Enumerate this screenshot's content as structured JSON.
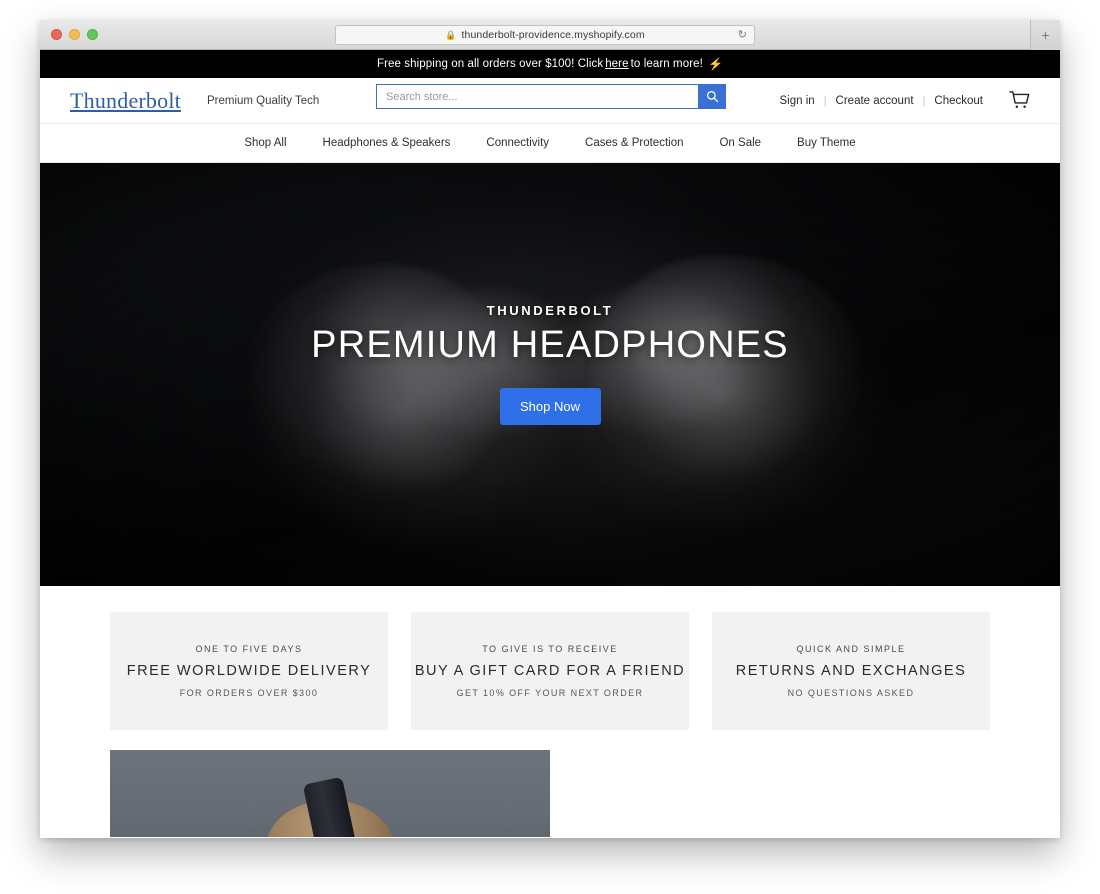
{
  "browser": {
    "url": "thunderbolt-providence.myshopify.com",
    "lock_icon": "lock-icon",
    "reload_icon": "reload-icon",
    "newtab_label": "+",
    "traffic_lights": [
      "close",
      "minimize",
      "zoom"
    ]
  },
  "announcement": {
    "text_before": "Free shipping on all orders over $100! Click",
    "link_label": "here",
    "text_after": "to learn more!",
    "bolt_icon": "lightning-bolt-icon"
  },
  "header": {
    "logo": "Thunderbolt",
    "tagline": "Premium Quality Tech",
    "logo_color": "#2d5fa8",
    "search": {
      "placeholder": "Search store...",
      "value": "",
      "button_icon": "search-icon",
      "accent_color": "#3a6fd4"
    },
    "links": [
      {
        "label": "Sign in"
      },
      {
        "label": "Create account"
      },
      {
        "label": "Checkout"
      }
    ],
    "separator": "|",
    "cart_icon": "shopping-cart-icon"
  },
  "nav": {
    "items": [
      {
        "label": "Shop All"
      },
      {
        "label": "Headphones & Speakers"
      },
      {
        "label": "Connectivity"
      },
      {
        "label": "Cases & Protection"
      },
      {
        "label": "On Sale"
      },
      {
        "label": "Buy Theme"
      }
    ]
  },
  "hero": {
    "eyebrow": "THUNDERBOLT",
    "title": "PREMIUM HEADPHONES",
    "cta_label": "Shop Now",
    "cta_color": "#2f6fe8",
    "image_alt": "black over-ear headphones on dark background"
  },
  "features": {
    "box_background": "#f2f2f2",
    "items": [
      {
        "eyebrow": "ONE TO FIVE DAYS",
        "title": "FREE WORLDWIDE DELIVERY",
        "sub": "FOR ORDERS OVER $300"
      },
      {
        "eyebrow": "TO GIVE IS TO RECEIVE",
        "title": "BUY A GIFT CARD FOR A FRIEND",
        "sub": "GET 10% OFF YOUR NEXT ORDER"
      },
      {
        "eyebrow": "QUICK AND SIMPLE",
        "title": "RETURNS AND EXCHANGES",
        "sub": "NO QUESTIONS ASKED"
      }
    ]
  },
  "bottom": {
    "image_alt": "person with blonde hair wearing headphones on grey background"
  }
}
